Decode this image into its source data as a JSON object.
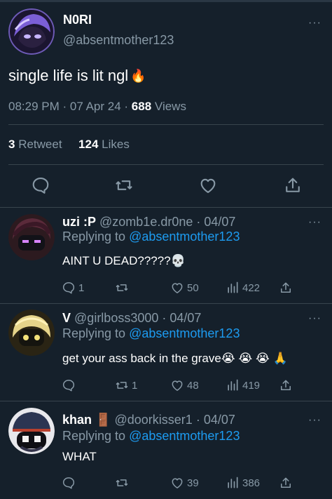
{
  "colors": {
    "background": "#15202b",
    "text": "#ffffff",
    "muted": "#8899a6",
    "link": "#1d9bf0",
    "divider": "#38444d"
  },
  "main_tweet": {
    "name": "N0RI",
    "handle": "@absentmother123",
    "text": "single life is lit ngl",
    "emoji": "🔥",
    "time": "08:29 PM",
    "date": "07 Apr 24",
    "views_count": "688",
    "views_label": "Views",
    "retweets_count": "3",
    "retweets_label": "Retweet",
    "likes_count": "124",
    "likes_label": "Likes",
    "more": "···",
    "actions": [
      "reply-icon",
      "retweet-icon",
      "like-icon",
      "share-icon"
    ]
  },
  "replies": [
    {
      "name": "uzi :P",
      "handle": "@zomb1e.dr0ne",
      "date": "04/07",
      "replying_label": "Replying to",
      "replying_to": "@absentmother123",
      "text": "AINT U DEAD?????💀",
      "replies": "1",
      "retweets": "",
      "likes": "50",
      "views": "422"
    },
    {
      "name": "V",
      "handle": "@girlboss3000",
      "date": "04/07",
      "replying_label": "Replying to",
      "replying_to": "@absentmother123",
      "text": "get your ass back in the grave😭 😭 😭 🙏",
      "replies": "",
      "retweets": "1",
      "likes": "48",
      "views": "419"
    },
    {
      "name": "khan",
      "name_emoji": "🚪",
      "handle": "@doorkisser1",
      "date": "04/07",
      "replying_label": "Replying to",
      "replying_to": "@absentmother123",
      "text": "WHAT",
      "replies": "",
      "retweets": "",
      "likes": "39",
      "views": "386"
    }
  ]
}
